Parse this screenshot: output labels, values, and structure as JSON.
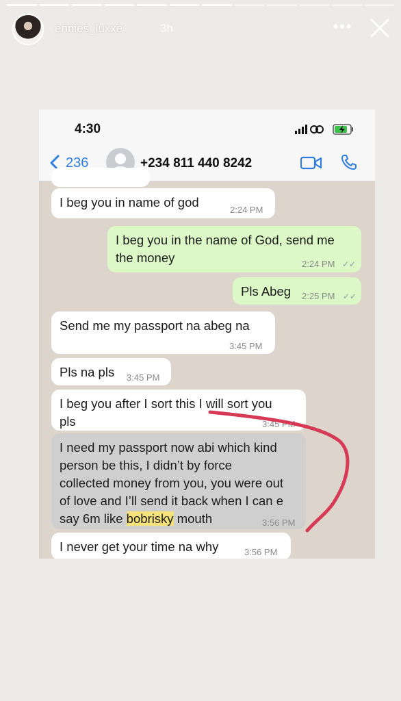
{
  "story": {
    "username": "ennies_luxxe",
    "time_ago": "3h"
  },
  "phone": {
    "clock": "4:30"
  },
  "chat_header": {
    "back_count": "236",
    "contact": "+234 811 440 8242"
  },
  "messages": [
    {
      "text": "I beg you in name of god",
      "time": "2:24 PM"
    },
    {
      "text_line1": "I beg you in the name of God, send me",
      "text_line2": "the money",
      "time": "2:24 PM"
    },
    {
      "text": "Pls Abeg",
      "time": "2:25 PM"
    },
    {
      "text": "Send me my passport na abeg na",
      "time": "3:45 PM"
    },
    {
      "text": "Pls na pls",
      "time": "3:45 PM"
    },
    {
      "text_line1": "I beg you after I sort this I will sort you",
      "text_line2": "pls",
      "time": "3:45 PM"
    },
    {
      "text_line1": "I need my passport now abi which kind",
      "text_line2": "person be this, I didn’t by force",
      "text_line3": "collected money from you, you were out",
      "text_line4": "of love and I’ll send it back when I can e",
      "text_line5_pre": "say 6m like ",
      "text_line5_hl": "bobrisky",
      "text_line5_post": " mouth",
      "time": "3:56 PM"
    },
    {
      "text": "I never get your time na why",
      "time": "3:56 PM"
    }
  ],
  "colors": {
    "incoming": "#ffffff",
    "outgoing": "#dcf8c6",
    "highlight": "#f6e27a",
    "annotation": "#d63a55",
    "ios_blue": "#2f7de1"
  }
}
